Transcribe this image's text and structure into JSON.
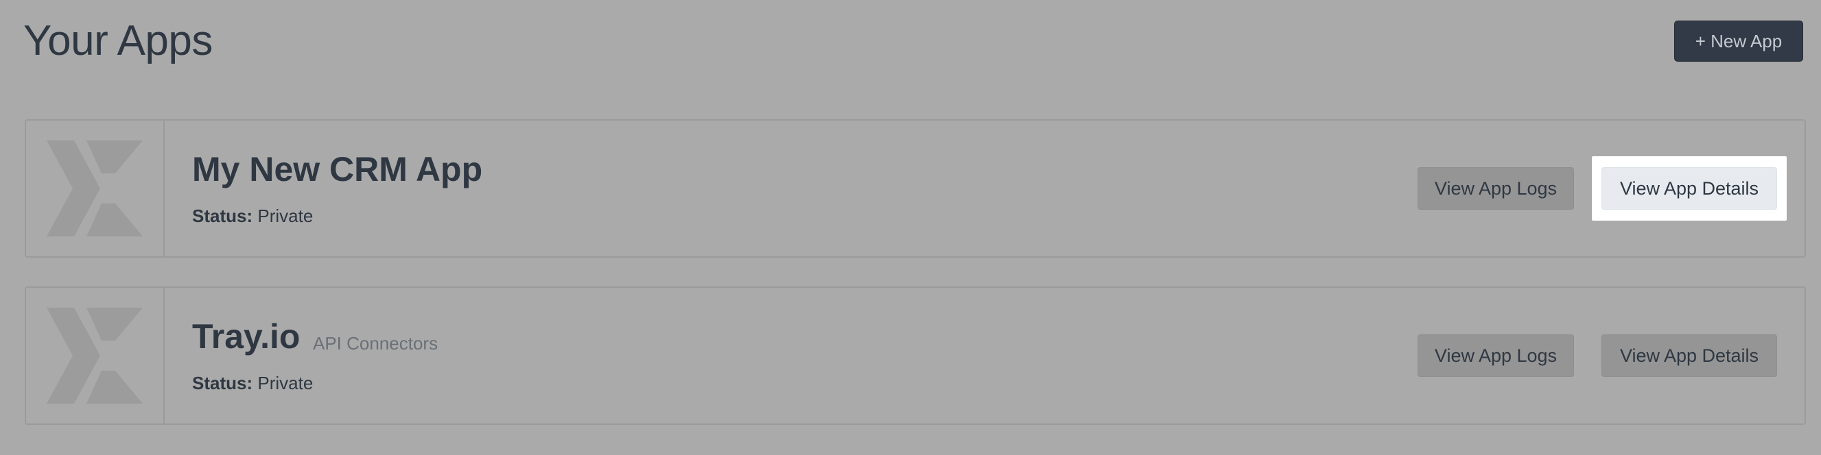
{
  "header": {
    "title": "Your Apps",
    "new_app_label": "+ New App"
  },
  "apps": [
    {
      "name": "My New CRM App",
      "tag": "",
      "status_label": "Status:",
      "status_value": "Private",
      "logs_label": "View App Logs",
      "details_label": "View App Details",
      "details_highlighted": true
    },
    {
      "name": "Tray.io",
      "tag": "API Connectors",
      "status_label": "Status:",
      "status_value": "Private",
      "logs_label": "View App Logs",
      "details_label": "View App Details",
      "details_highlighted": false
    }
  ],
  "colors": {
    "overlay_background": "#aaaaaa",
    "primary_button": "#313a46",
    "highlight": "#ffffff"
  },
  "icons": {
    "app_logo": "tray-x-logo-icon"
  }
}
